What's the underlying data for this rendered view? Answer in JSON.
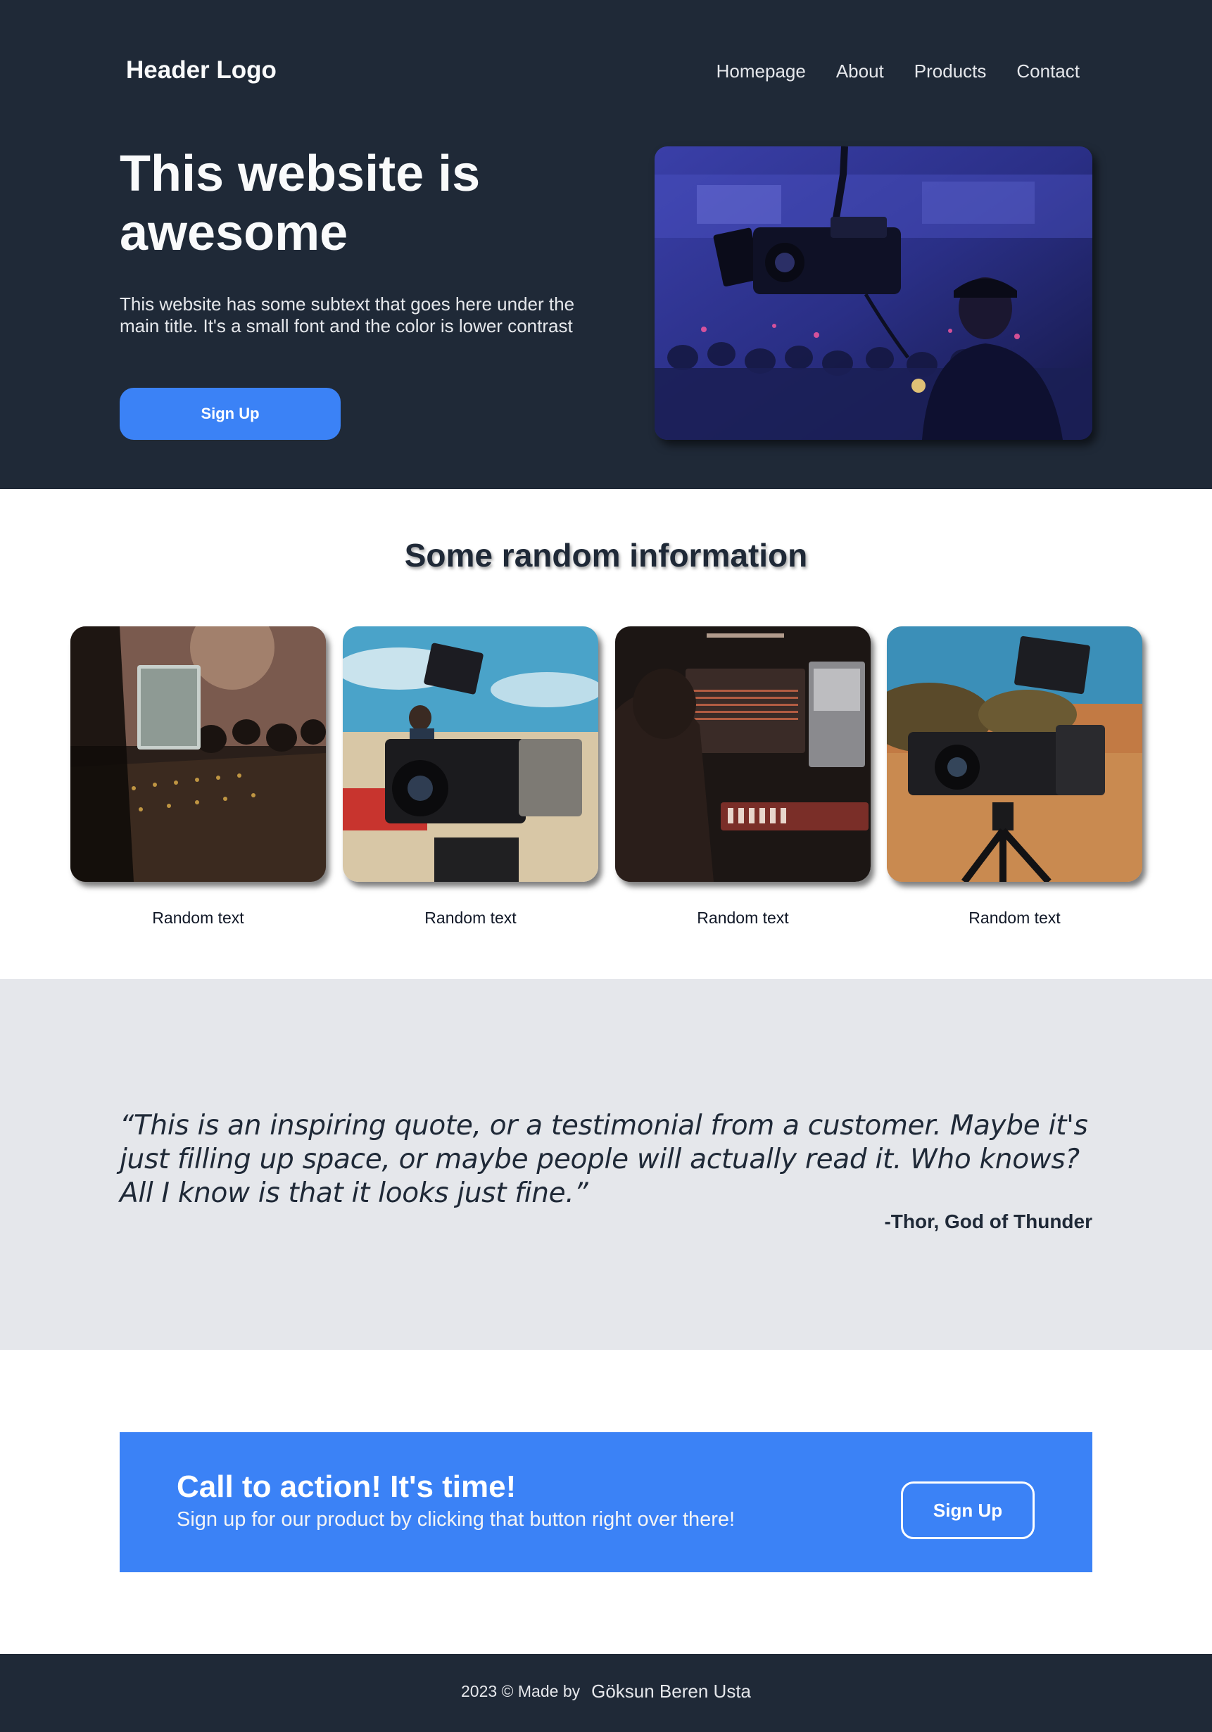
{
  "header": {
    "logo": "Header Logo",
    "nav": [
      "Homepage",
      "About",
      "Products",
      "Contact"
    ]
  },
  "hero": {
    "title": "This website is awesome",
    "subtitle": "This website has some subtext that goes here under the main title. It's a small font and the color is lower contrast",
    "button": "Sign Up",
    "image": "camera-operator-photo"
  },
  "info": {
    "title": "Some random information",
    "cards": [
      {
        "text": "Random text",
        "image": "audio-mixer-photo"
      },
      {
        "text": "Random text",
        "image": "cinema-camera-photo"
      },
      {
        "text": "Random text",
        "image": "video-editing-photo"
      },
      {
        "text": "Random text",
        "image": "camera-on-tripod-photo"
      }
    ]
  },
  "quote": {
    "text": "“This is an inspiring quote, or a testimonial from a customer. Maybe it's just filling up space, or maybe people will actually read it. Who knows? All I know is that it looks just fine.”",
    "author": "-Thor, God of Thunder"
  },
  "cta": {
    "title": "Call to action! It's time!",
    "subtitle": "Sign up for our product by clicking that button right over there!",
    "button": "Sign Up"
  },
  "footer": {
    "copyright": "2023 © Made by",
    "author": "Göksun Beren Usta"
  },
  "colors": {
    "dark": "#1f2937",
    "accent": "#3b82f6",
    "light_gray": "#e5e7eb"
  }
}
